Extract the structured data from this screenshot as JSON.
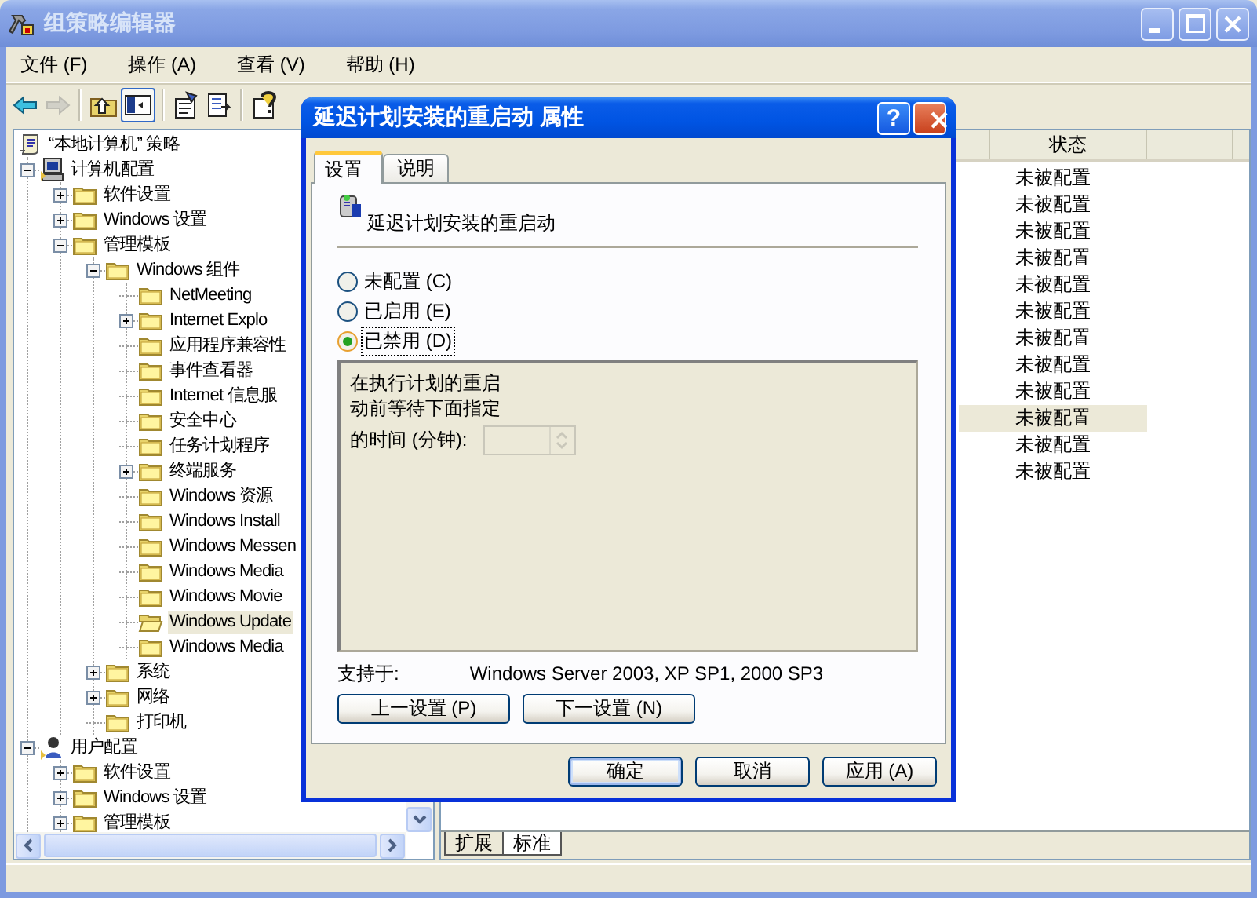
{
  "window": {
    "title": "组策略编辑器",
    "active": false
  },
  "menu": [
    {
      "label": "文件 (F)"
    },
    {
      "label": "操作 (A)"
    },
    {
      "label": "查看 (V)"
    },
    {
      "label": "帮助 (H)"
    }
  ],
  "toolbar": [
    {
      "kind": "back",
      "disabled": false,
      "pressed": false
    },
    {
      "kind": "forward",
      "disabled": true,
      "pressed": false
    },
    {
      "kind": "separator"
    },
    {
      "kind": "up",
      "disabled": false,
      "pressed": false
    },
    {
      "kind": "tree",
      "disabled": false,
      "pressed": true
    },
    {
      "kind": "separator"
    },
    {
      "kind": "properties",
      "disabled": false,
      "pressed": false
    },
    {
      "kind": "export",
      "disabled": false,
      "pressed": false
    },
    {
      "kind": "separator"
    },
    {
      "kind": "help",
      "disabled": false,
      "pressed": false
    }
  ],
  "tree": [
    {
      "label": "“本地计算机” 策略",
      "kind": "policy",
      "selected": false,
      "children": [
        {
          "label": "计算机配置",
          "kind": "computer",
          "expanded": true,
          "selected": false,
          "children": [
            {
              "label": "软件设置",
              "kind": "folder",
              "expanded": false,
              "selected": false
            },
            {
              "label": "Windows 设置",
              "kind": "folder",
              "expanded": false,
              "selected": false
            },
            {
              "label": "管理模板",
              "kind": "folder",
              "expanded": true,
              "selected": false,
              "children": [
                {
                  "label": "Windows 组件",
                  "kind": "folder",
                  "expanded": true,
                  "selected": false,
                  "children": [
                    {
                      "label": "NetMeeting",
                      "kind": "folder",
                      "selected": false
                    },
                    {
                      "label": "Internet Explo",
                      "kind": "folder",
                      "expanded": false,
                      "selected": false
                    },
                    {
                      "label": "应用程序兼容性",
                      "kind": "folder",
                      "selected": false
                    },
                    {
                      "label": "事件查看器",
                      "kind": "folder",
                      "selected": false
                    },
                    {
                      "label": "Internet 信息服",
                      "kind": "folder",
                      "selected": false
                    },
                    {
                      "label": "安全中心",
                      "kind": "folder",
                      "selected": false
                    },
                    {
                      "label": "任务计划程序",
                      "kind": "folder",
                      "selected": false
                    },
                    {
                      "label": "终端服务",
                      "kind": "folder",
                      "expanded": false,
                      "selected": false
                    },
                    {
                      "label": "Windows 资源",
                      "kind": "folder",
                      "selected": false
                    },
                    {
                      "label": "Windows Install",
                      "kind": "folder",
                      "selected": false
                    },
                    {
                      "label": "Windows Messen",
                      "kind": "folder",
                      "selected": false
                    },
                    {
                      "label": "Windows Media",
                      "kind": "folder",
                      "selected": false
                    },
                    {
                      "label": "Windows Movie",
                      "kind": "folder",
                      "selected": false
                    },
                    {
                      "label": "Windows Update",
                      "kind": "folder",
                      "selected": true
                    },
                    {
                      "label": "Windows Media",
                      "kind": "folder",
                      "selected": false
                    }
                  ]
                },
                {
                  "label": "系统",
                  "kind": "folder",
                  "expanded": false,
                  "selected": false
                },
                {
                  "label": "网络",
                  "kind": "folder",
                  "expanded": false,
                  "selected": false
                },
                {
                  "label": "打印机",
                  "kind": "folder",
                  "selected": false
                }
              ]
            }
          ]
        },
        {
          "label": "用户配置",
          "kind": "user",
          "expanded": true,
          "selected": false,
          "children": [
            {
              "label": "软件设置",
              "kind": "folder",
              "expanded": false,
              "selected": false
            },
            {
              "label": "Windows 设置",
              "kind": "folder",
              "expanded": false,
              "selected": false
            },
            {
              "label": "管理模板",
              "kind": "folder",
              "expanded": false,
              "selected": false
            }
          ]
        }
      ]
    }
  ],
  "list": {
    "columns": [
      "状态"
    ],
    "rows": [
      {
        "status": "未被配置",
        "selected": false
      },
      {
        "status": "未被配置",
        "selected": false
      },
      {
        "status": "未被配置",
        "selected": false
      },
      {
        "status": "未被配置",
        "selected": false
      },
      {
        "status": "未被配置",
        "selected": false
      },
      {
        "status": "未被配置",
        "selected": false
      },
      {
        "status": "未被配置",
        "selected": false
      },
      {
        "status": "未被配置",
        "selected": false
      },
      {
        "status": "未被配置",
        "selected": false
      },
      {
        "status": "未被配置",
        "selected": true
      },
      {
        "status": "未被配置",
        "selected": false
      },
      {
        "status": "未被配置",
        "selected": false
      }
    ]
  },
  "view_tabs": [
    {
      "label": "扩展",
      "selected": false
    },
    {
      "label": "标准",
      "selected": true
    }
  ],
  "dialog": {
    "title": "延迟计划安装的重启动 属性",
    "active": true,
    "help_button": "?",
    "tabs": [
      {
        "label": "设置",
        "selected": true
      },
      {
        "label": "说明",
        "selected": false
      }
    ],
    "policy_name": "延迟计划安装的重启动",
    "options": [
      {
        "label": "未配置 (C)",
        "selected": false,
        "focused": false
      },
      {
        "label": "已启用 (E)",
        "selected": false,
        "focused": false
      },
      {
        "label": "已禁用 (D)",
        "selected": true,
        "focused": true
      }
    ],
    "panel": {
      "description": [
        "在执行计划的重启",
        "动前等待下面指定"
      ],
      "field_label": "的时间 (分钟):",
      "field_disabled": true
    },
    "supported_label": "支持于:",
    "supported_value": "Windows Server 2003, XP SP1, 2000 SP3",
    "nav_buttons": [
      {
        "label": "上一设置 (P)"
      },
      {
        "label": "下一设置 (N)"
      }
    ],
    "buttons": [
      {
        "label": "确定",
        "default": true
      },
      {
        "label": "取消",
        "default": false
      },
      {
        "label": "应用 (A)",
        "default": false
      }
    ]
  }
}
